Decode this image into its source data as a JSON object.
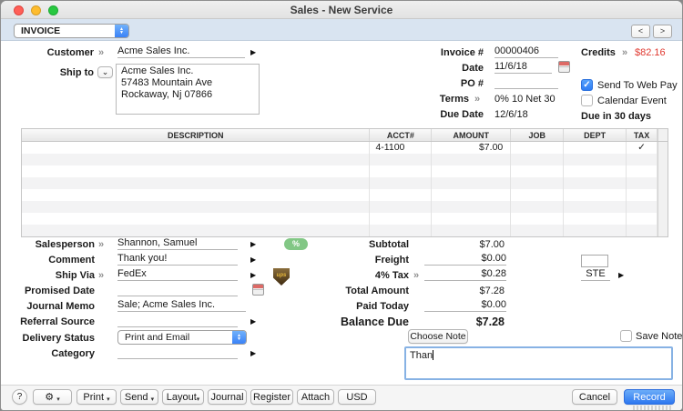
{
  "window": {
    "title": "Sales - New Service"
  },
  "glyphs": {
    "chevron": "»",
    "arrow": "▶",
    "check": "✓",
    "caret": "▾",
    "up": "▲",
    "down": "▼",
    "vee": "⌄",
    "prev": "<",
    "next": ">"
  },
  "topbar": {
    "type_selector": "INVOICE"
  },
  "customer": {
    "label": "Customer",
    "name": "Acme Sales Inc.",
    "ship_to_label": "Ship to",
    "address": "Acme Sales Inc.\n57483 Mountain Ave\nRockaway, Nj 07866"
  },
  "invoice": {
    "number_label": "Invoice #",
    "number": "00000406",
    "date_label": "Date",
    "date": "11/6/18",
    "po_label": "PO #",
    "po": "",
    "terms_label": "Terms",
    "terms": "0% 10 Net 30",
    "due_date_label": "Due Date",
    "due_date": "12/6/18",
    "credits_label": "Credits",
    "credits": "$82.16",
    "send_web_pay": "Send To Web Pay",
    "calendar_event": "Calendar Event",
    "due_in": "Due in 30 days"
  },
  "table": {
    "headers": {
      "description": "DESCRIPTION",
      "acct": "ACCT#",
      "amount": "AMOUNT",
      "job": "JOB",
      "dept": "DEPT",
      "tax": "TAX"
    },
    "rows": [
      {
        "description": "",
        "acct": "4-1100",
        "amount": "$7.00",
        "job": "",
        "dept": "",
        "tax": "✓"
      }
    ]
  },
  "details": {
    "salesperson_label": "Salesperson",
    "salesperson": "Shannon, Samuel",
    "commission_badge": "%",
    "comment_label": "Comment",
    "comment": "Thank you!",
    "ship_via_label": "Ship Via",
    "ship_via": "FedEx",
    "ship_via_icon": "ups",
    "promised_date_label": "Promised Date",
    "promised_date": "",
    "journal_memo_label": "Journal Memo",
    "journal_memo": "Sale; Acme Sales Inc.",
    "referral_label": "Referral Source",
    "referral": "",
    "delivery_status_label": "Delivery Status",
    "delivery_status": "Print and Email",
    "category_label": "Category",
    "category": ""
  },
  "totals": {
    "subtotal_label": "Subtotal",
    "subtotal": "$7.00",
    "freight_label": "Freight",
    "freight": "$0.00",
    "tax_label": "4% Tax",
    "tax": "$0.28",
    "tax_code": "STE",
    "total_label": "Total Amount",
    "total": "$7.28",
    "paid_label": "Paid Today",
    "paid": "$0.00",
    "balance_label": "Balance Due",
    "balance": "$7.28"
  },
  "note": {
    "choose": "Choose Note",
    "save": "Save Note",
    "text": "Than"
  },
  "toolbar": {
    "help": "?",
    "gear": "⚙",
    "print": "Print",
    "send": "Send",
    "layout": "Layout",
    "journal": "Journal",
    "register": "Register",
    "attach": "Attach",
    "currency": "USD",
    "cancel": "Cancel",
    "record": "Record"
  },
  "colors": {
    "accent_blue": "#2f7cf6",
    "credits_red": "#e0382f",
    "badge_green": "#82c785",
    "topbar_blue": "#d9e4f1"
  }
}
